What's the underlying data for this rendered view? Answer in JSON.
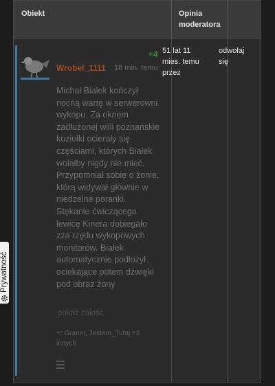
{
  "table": {
    "headers": {
      "object": "Obiekt",
      "moderator_opinion": "Opinia moderatora"
    },
    "row": {
      "moderator_time": "51 lat 11 mies. temu przez",
      "action": "odwołaj się"
    }
  },
  "entry": {
    "author": "Wrobel_1111",
    "time": "18 min. temu",
    "votes": "+4",
    "text": "Michał Białek kończył nocną wartę w serwerowni wykopu. Za oknem zadłużonej willi poznańskie koziołki ocierały się częściami, których Białek wolałby nigdy nie mieć. Przypomniał sobie o żonie, którą widywał głównie w niedzelne poranki.\nStękanie ćwiczącego lewicę Kinera dobiegało zza rzędu wykopowych monitorów. Białek automatycznie podłożył ociekające potem dźwięki pod obraz żony",
    "show_all": "pokaż całość",
    "likers": "+: Graner, Jestem_Tutaj +2 innych",
    "author_color": "#b8501f",
    "votes_color": "#3d8b48",
    "accent_color": "#3f79a8"
  },
  "privacy_tab": {
    "label": "Prywatność",
    "icon": "gear-icon"
  }
}
